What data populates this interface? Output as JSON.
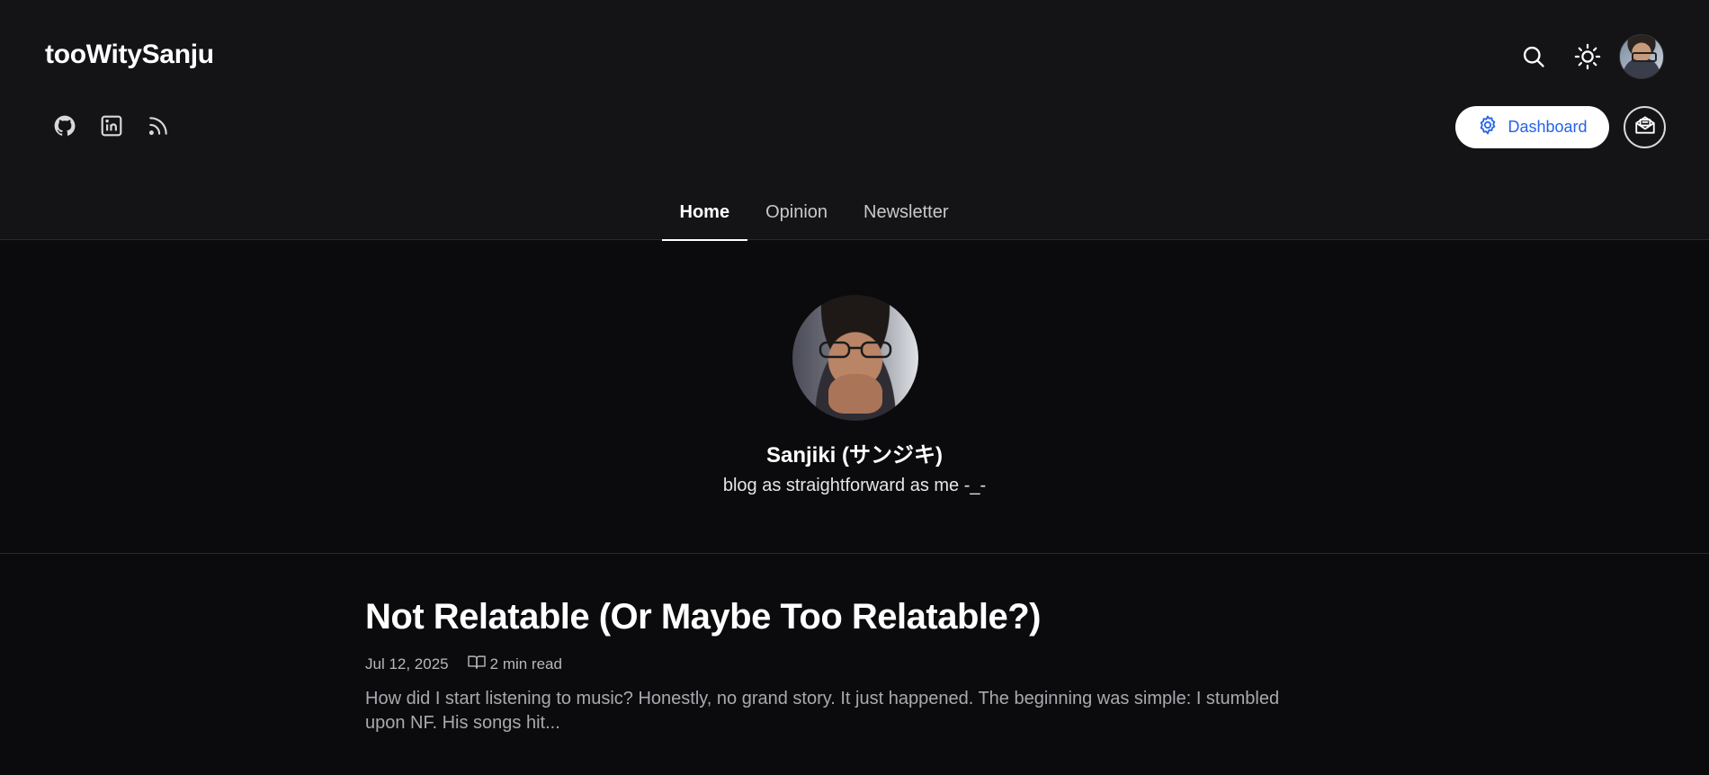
{
  "header": {
    "brand": "tooWitySanju",
    "icons": {
      "search": "search-icon",
      "theme": "sun-icon",
      "avatar": "user-avatar"
    },
    "social": [
      {
        "name": "github-icon"
      },
      {
        "name": "linkedin-icon"
      },
      {
        "name": "rss-icon"
      }
    ],
    "dashboard_label": "Dashboard",
    "dashboard_icon": "gear-icon",
    "newsletter_icon": "mail-open-icon"
  },
  "nav": {
    "tabs": [
      {
        "label": "Home",
        "active": true
      },
      {
        "label": "Opinion",
        "active": false
      },
      {
        "label": "Newsletter",
        "active": false
      }
    ]
  },
  "profile": {
    "name": "Sanjiki (サンジキ)",
    "tagline": "blog as straightforward as me -_-"
  },
  "posts": [
    {
      "title": "Not Relatable (Or Maybe Too Relatable?)",
      "date": "Jul 12, 2025",
      "read_time": "2 min read",
      "excerpt": "How did I start listening to music? Honestly, no grand story. It just happened. The beginning was simple: I stumbled upon NF. His songs hit..."
    }
  ],
  "colors": {
    "background": "#0b0b0d",
    "header_background": "#141417",
    "accent": "#2563eb",
    "text": "#ffffff",
    "muted": "#a9a9ae"
  }
}
